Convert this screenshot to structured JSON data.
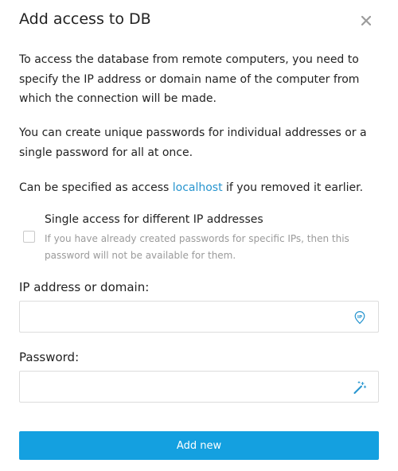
{
  "dialog": {
    "title": "Add access to DB",
    "close_icon": "close-icon"
  },
  "intro": {
    "paragraph_1": "To access the database from remote computers, you need to specify the IP address or domain name of the computer from which the connection will be made.",
    "paragraph_2": "You can create unique passwords for individual addresses or a single password for all at once.",
    "paragraph_3_before": "Can be specified as access ",
    "paragraph_3_link": "localhost",
    "paragraph_3_after": " if you removed it earlier."
  },
  "single_access": {
    "label": "Single access for different IP addresses",
    "hint": "If you have already created passwords for specific IPs, then this password will not be available for them.",
    "checked": false
  },
  "ip_field": {
    "label": "IP address or domain:",
    "value": "",
    "icon": "ip-location-icon"
  },
  "password_field": {
    "label": "Password:",
    "value": "",
    "icon": "magic-wand-icon"
  },
  "submit": {
    "label": "Add new"
  },
  "colors": {
    "accent": "#14a0e0",
    "link": "#2795cf",
    "hint": "#9a9a9a"
  }
}
